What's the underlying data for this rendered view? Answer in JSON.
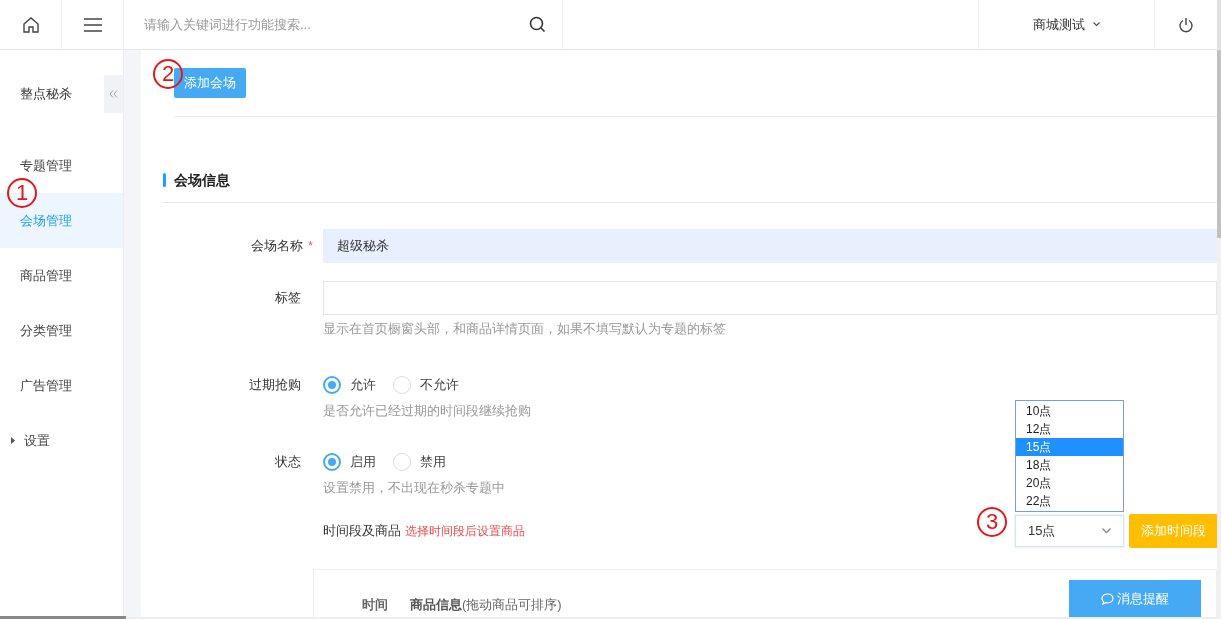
{
  "topbar": {
    "search": {
      "placeholder": "请输入关键词进行功能搜索..."
    },
    "store": "商城测试"
  },
  "sidebar": {
    "title": "整点秘杀",
    "items": [
      {
        "label": "专题管理",
        "kind": "link",
        "selected": false
      },
      {
        "label": "会场管理",
        "kind": "link",
        "selected": true
      },
      {
        "label": "商品管理",
        "kind": "link",
        "selected": false
      },
      {
        "label": "分类管理",
        "kind": "link",
        "selected": false
      },
      {
        "label": "广告管理",
        "kind": "link",
        "selected": false
      },
      {
        "label": "设置",
        "kind": "group",
        "selected": false,
        "expanded": false
      }
    ]
  },
  "add_button": "添加会场",
  "section_title": "会场信息",
  "fields": [
    {
      "kind": "text",
      "label": "会场名称",
      "required_mark": "*",
      "value": "超级秘杀",
      "autofilled": true
    },
    {
      "kind": "text",
      "label": "标签",
      "hint": "显示在首页橱窗头部，和商品详情页面，如果不填写默认为专题的标签",
      "autofilled": false
    },
    {
      "kind": "radio",
      "label": "过期抢购",
      "options": [
        {
          "label": "允许",
          "selected": true
        },
        {
          "label": "不允许",
          "selected": false
        }
      ],
      "hint": "是否允许已经过期的时间段继续抢购"
    },
    {
      "kind": "radio",
      "label": "状态",
      "options": [
        {
          "label": "启用",
          "selected": true
        },
        {
          "label": "禁用",
          "selected": false
        }
      ],
      "hint": "设置禁用，不出现在秒杀专题中"
    }
  ],
  "time_slots": {
    "label": "时间段及商品",
    "note": "选择时间段后设置商品",
    "select": {
      "value": "15点",
      "expanded": true,
      "options": [
        {
          "label": "10点",
          "selected": false
        },
        {
          "label": "12点",
          "selected": false
        },
        {
          "label": "15点",
          "selected": true
        },
        {
          "label": "18点",
          "selected": false
        },
        {
          "label": "20点",
          "selected": false
        },
        {
          "label": "22点",
          "selected": false
        }
      ]
    },
    "add_button": "添加时间段"
  },
  "table": {
    "columns": [
      "时间",
      "**商品信息**(拖动商品可排序)"
    ]
  },
  "message_button": "消息提醒",
  "annotations": [
    {
      "label": "1"
    },
    {
      "label": "2"
    },
    {
      "label": "3"
    }
  ]
}
